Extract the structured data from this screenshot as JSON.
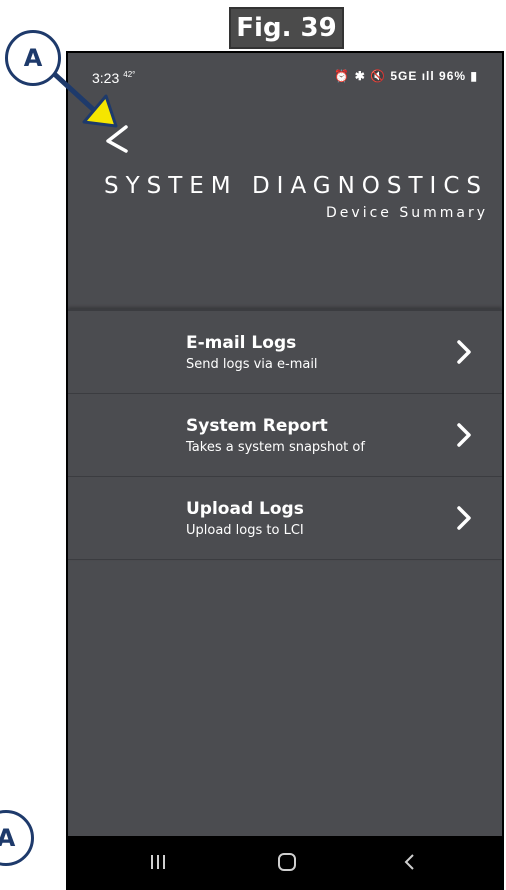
{
  "figure": {
    "label": "Fig. 39",
    "callout_letter": "A"
  },
  "status_bar": {
    "time": "3:23",
    "temp": "42°",
    "icons_text": "⏰ ✱ 🔇 5GE ıll 96% ▮"
  },
  "header": {
    "title": "SYSTEM DIAGNOSTICS",
    "subtitle": "Device Summary"
  },
  "menu": {
    "items": [
      {
        "title": "E-mail Logs",
        "subtitle": "Send logs via e-mail"
      },
      {
        "title": "System Report",
        "subtitle": "Takes a system snapshot of"
      },
      {
        "title": "Upload Logs",
        "subtitle": "Upload logs to LCI"
      }
    ]
  },
  "colors": {
    "background": "#4b4c50",
    "callout_border": "#1e3a6b",
    "arrow": "#f5e600"
  }
}
